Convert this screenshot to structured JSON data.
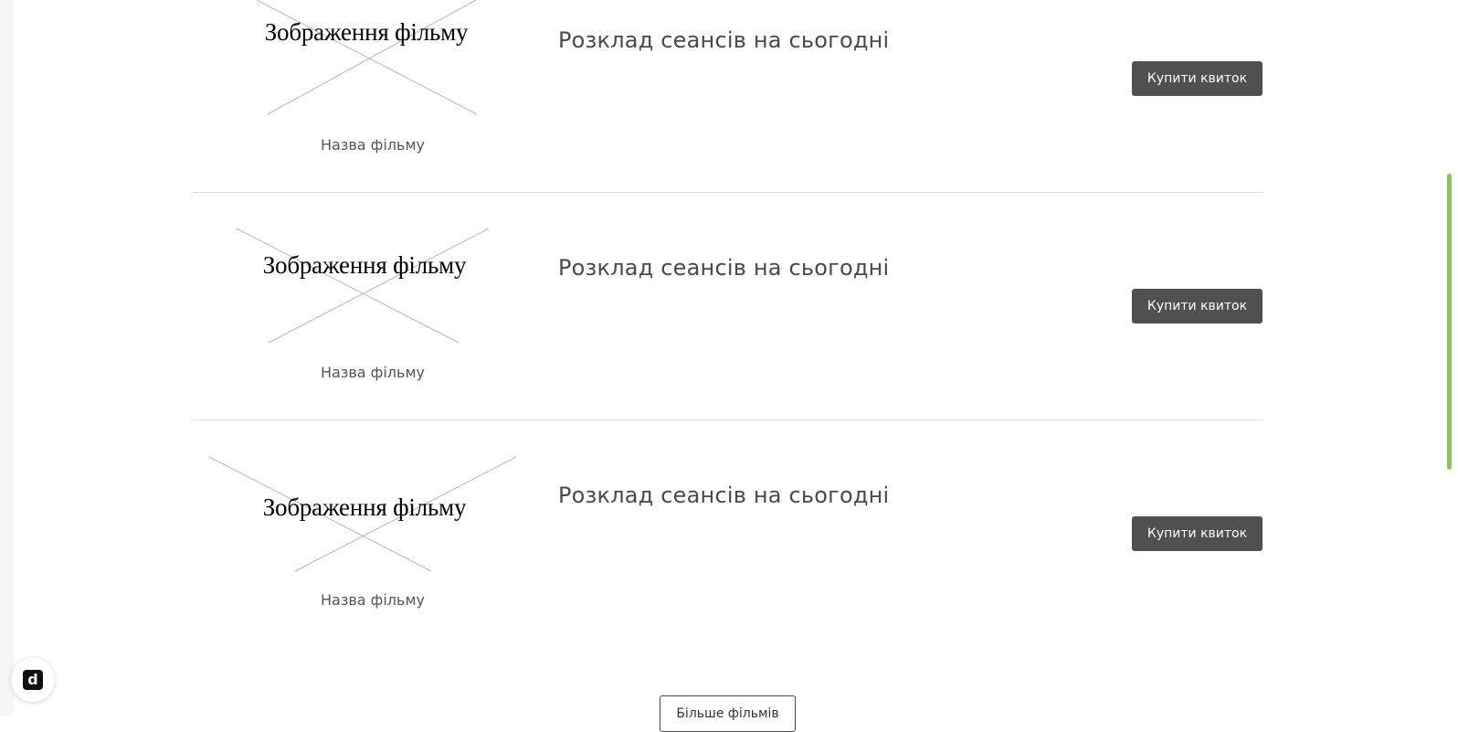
{
  "movies": [
    {
      "poster_alt": "Зображення фільму",
      "title": "Назва фільму",
      "schedule_heading": "Розклад сеансів на сьогодні",
      "buy_label": "Купити квиток"
    },
    {
      "poster_alt": "Зображення фільму",
      "title": "Назва фільму",
      "schedule_heading": "Розклад сеансів на сьогодні",
      "buy_label": "Купити квиток"
    },
    {
      "poster_alt": "Зображення фільму",
      "title": "Назва фільму",
      "schedule_heading": "Розклад сеансів на сьогодні",
      "buy_label": "Купити квиток"
    }
  ],
  "more_button": {
    "label": "Більше фільмів"
  },
  "widget": {
    "icon": "d-logo-icon",
    "glyph": "d"
  },
  "colors": {
    "button_bg": "#505050",
    "scroll_thumb": "#8fbf6a",
    "divider": "#dcdcdc"
  }
}
